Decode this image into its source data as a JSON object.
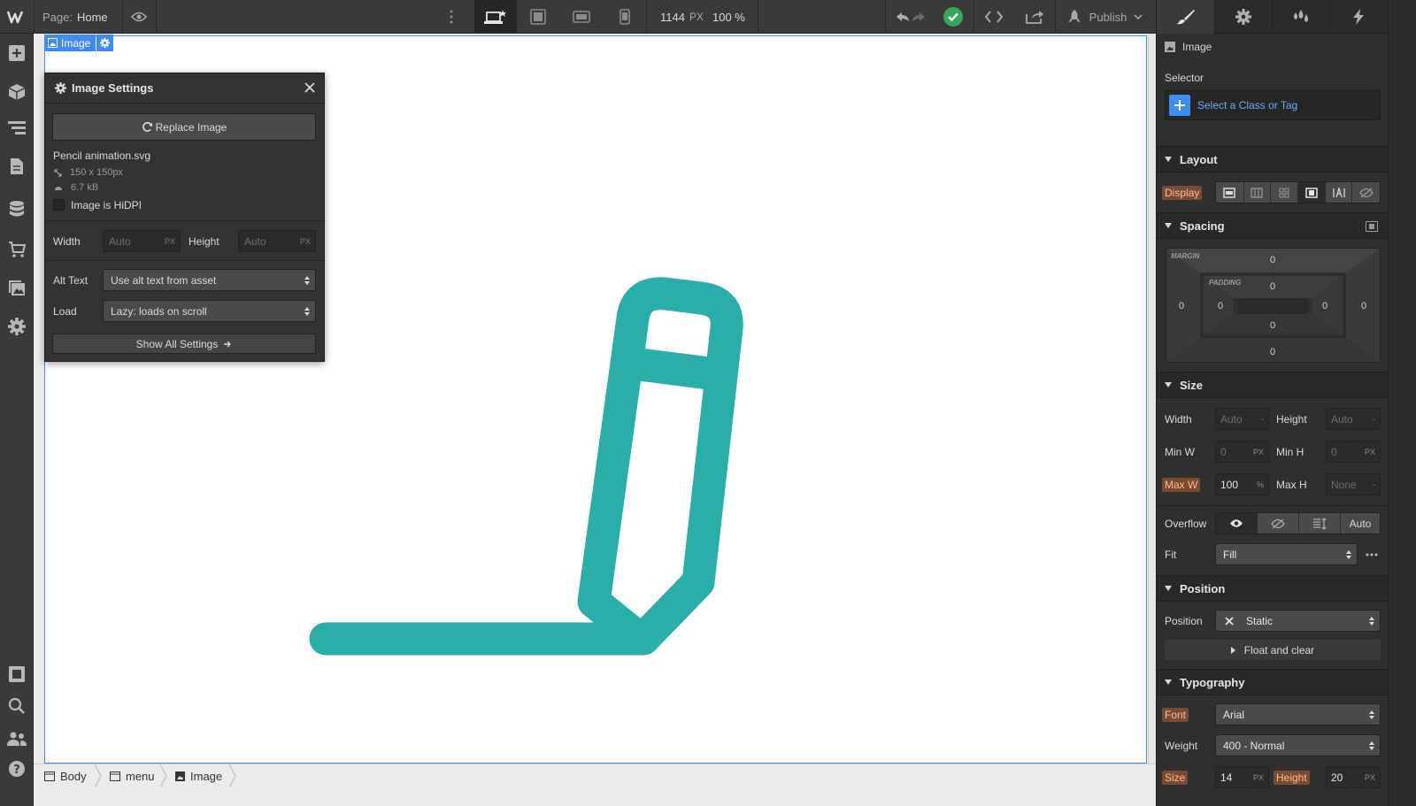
{
  "topbar": {
    "page_label": "Page:",
    "page_name": "Home",
    "width": "1144",
    "width_unit": "PX",
    "zoom": "100 %",
    "publish_label": "Publish"
  },
  "canvas": {
    "selected_tag": "Image",
    "image_color": "#2aafa8"
  },
  "image_settings": {
    "title": "Image Settings",
    "replace_label": "Replace Image",
    "file_name": "Pencil animation.svg",
    "dimensions": "150 x 150px",
    "file_size": "6.7 kB",
    "hidpi_label": "Image is HiDPI",
    "width_label": "Width",
    "width_placeholder": "Auto",
    "height_label": "Height",
    "height_placeholder": "Auto",
    "unit": "PX",
    "alt_label": "Alt Text",
    "alt_value": "Use alt text from asset",
    "load_label": "Load",
    "load_value": "Lazy: loads on scroll",
    "show_all": "Show All Settings"
  },
  "style_panel": {
    "element_name": "Image",
    "selector_label": "Selector",
    "selector_placeholder": "Select a Class or Tag",
    "layout": {
      "title": "Layout",
      "display_label": "Display"
    },
    "spacing": {
      "title": "Spacing",
      "margin_caption": "MARGIN",
      "padding_caption": "PADDING",
      "margin_top": "0",
      "margin_right": "0",
      "margin_bottom": "0",
      "margin_left": "0",
      "padding_top": "0",
      "padding_right": "0",
      "padding_bottom": "0",
      "padding_left": "0"
    },
    "size": {
      "title": "Size",
      "width_label": "Width",
      "width_value": "Auto",
      "width_unit": "-",
      "height_label": "Height",
      "height_value": "Auto",
      "height_unit": "-",
      "minw_label": "Min W",
      "minw_value": "0",
      "minw_unit": "PX",
      "minh_label": "Min H",
      "minh_value": "0",
      "minh_unit": "PX",
      "maxw_label": "Max W",
      "maxw_value": "100",
      "maxw_unit": "%",
      "maxh_label": "Max H",
      "maxh_value": "None",
      "maxh_unit": "-",
      "overflow_label": "Overflow",
      "overflow_auto": "Auto",
      "fit_label": "Fit",
      "fit_value": "Fill"
    },
    "position": {
      "title": "Position",
      "position_label": "Position",
      "position_value": "Static",
      "float_label": "Float and clear"
    },
    "typography": {
      "title": "Typography",
      "font_label": "Font",
      "font_value": "Arial",
      "weight_label": "Weight",
      "weight_value": "400 - Normal",
      "size_label": "Size",
      "size_value": "14",
      "size_unit": "PX",
      "height_label": "Height",
      "height_value": "20",
      "height_unit": "PX"
    }
  },
  "breadcrumbs": [
    {
      "label": "Body"
    },
    {
      "label": "menu"
    },
    {
      "label": "Image"
    }
  ]
}
